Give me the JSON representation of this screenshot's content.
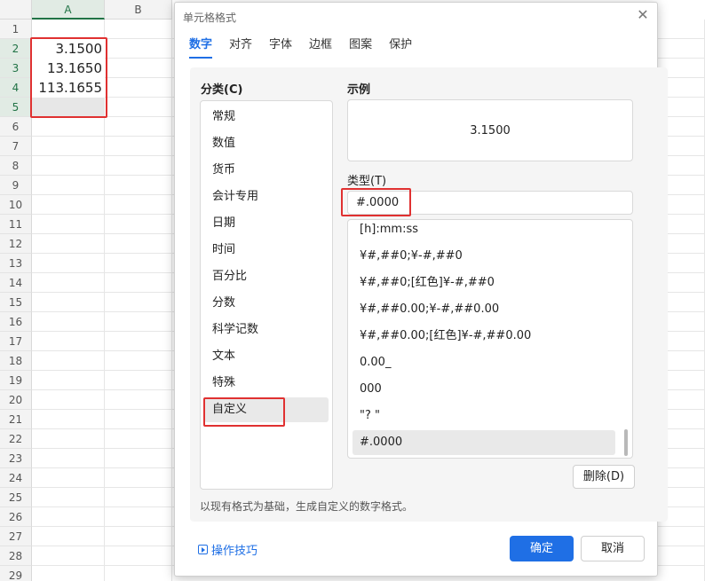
{
  "sheet": {
    "columns": [
      "A",
      "B"
    ],
    "rows": [
      "1",
      "2",
      "3",
      "4",
      "5",
      "6",
      "7",
      "8",
      "9",
      "10",
      "11",
      "12",
      "13",
      "14",
      "15",
      "16",
      "17",
      "18",
      "19",
      "20",
      "21",
      "22",
      "23",
      "24",
      "25",
      "26",
      "27",
      "28",
      "29"
    ],
    "values": [
      "3.1500",
      "13.1650",
      "113.1655"
    ]
  },
  "dialog": {
    "title": "单元格格式",
    "close_icon": "close-icon",
    "tabs": [
      "数字",
      "对齐",
      "字体",
      "边框",
      "图案",
      "保护"
    ],
    "category_label": "分类(C)",
    "categories": [
      "常规",
      "数值",
      "货币",
      "会计专用",
      "日期",
      "时间",
      "百分比",
      "分数",
      "科学记数",
      "文本",
      "特殊",
      "自定义"
    ],
    "selected_category": "自定义",
    "sample_label": "示例",
    "sample_value": "3.1500",
    "type_label": "类型(T)",
    "type_value": "#.0000",
    "formats": [
      "[h]:mm:ss",
      "¥#,##0;¥-#,##0",
      "¥#,##0;[红色]¥-#,##0",
      "¥#,##0.00;¥-#,##0.00",
      "¥#,##0.00;[红色]¥-#,##0.00",
      "0.00_",
      "000",
      "\"? \"",
      "#.0000"
    ],
    "selected_format": "#.0000",
    "delete_label": "删除(D)",
    "hint": "以现有格式为基础，生成自定义的数字格式。",
    "tips_label": "操作技巧",
    "ok_label": "确定",
    "cancel_label": "取消"
  },
  "colors": {
    "accent": "#1f6fe5",
    "highlight": "#e03131",
    "sheet_header_selected": "#217346"
  }
}
